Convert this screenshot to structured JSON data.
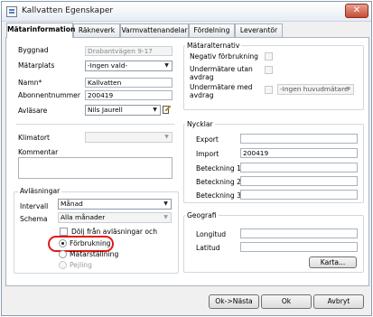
{
  "window": {
    "title": "Kallvatten Egenskaper",
    "close_glyph": "✕"
  },
  "tabs": [
    {
      "label": "Mätarinformation",
      "active": true
    },
    {
      "label": "Räkneverk"
    },
    {
      "label": "Varmvattenandelar"
    },
    {
      "label": "Fördelning"
    },
    {
      "label": "Leverantör"
    }
  ],
  "left": {
    "byggnad_label": "Byggnad",
    "byggnad_value": "Drabantvägen 9-17",
    "matarplats_label": "Mätarplats",
    "matarplats_value": "-Ingen vald-",
    "namn_label": "Namn*",
    "namn_value": "Kallvatten",
    "abonnent_label": "Abonnentnummer",
    "abonnent_value": "200419",
    "avlasare_label": "Avläsare",
    "avlasare_value": "Nils Jaurell",
    "klimatort_label": "Klimatort",
    "klimatort_value": "",
    "kommentar_label": "Kommentar"
  },
  "avlasningar": {
    "group_label": "Avläsningar",
    "intervall_label": "Intervall",
    "intervall_value": "Månad",
    "schema_label": "Schema",
    "schema_value": "Alla månader",
    "dolj_label": "Dölj från avläsningar och",
    "radio_forbrukning": "Förbrukning",
    "radio_matarstallning": "Mätarställning",
    "radio_pejling": "Pejling"
  },
  "mataralternativ": {
    "group_label": "Mätaralternativ",
    "negativ_label": "Negativ förbrukning",
    "undermatare_utan_label": [
      "Undermätare utan",
      "avdrag"
    ],
    "undermatare_med_label": [
      "Undermätare med",
      "avdrag"
    ],
    "huvudmatare_value": "-Ingen huvudmätare-"
  },
  "nycklar": {
    "group_label": "Nycklar",
    "export_label": "Export",
    "export_value": "",
    "import_label": "Import",
    "import_value": "200419",
    "beteckning1_label": "Beteckning 1",
    "beteckning2_label": "Beteckning 2",
    "beteckning3_label": "Beteckning 3"
  },
  "geografi": {
    "group_label": "Geografi",
    "longitud_label": "Longitud",
    "latitud_label": "Latitud",
    "karta_button": "Karta..."
  },
  "footer": {
    "ok_nasta": "Ok->Nästa",
    "ok": "Ok",
    "avbryt": "Avbryt"
  },
  "colors": {
    "highlight": "#e01818",
    "close_button": "#c84c36"
  }
}
